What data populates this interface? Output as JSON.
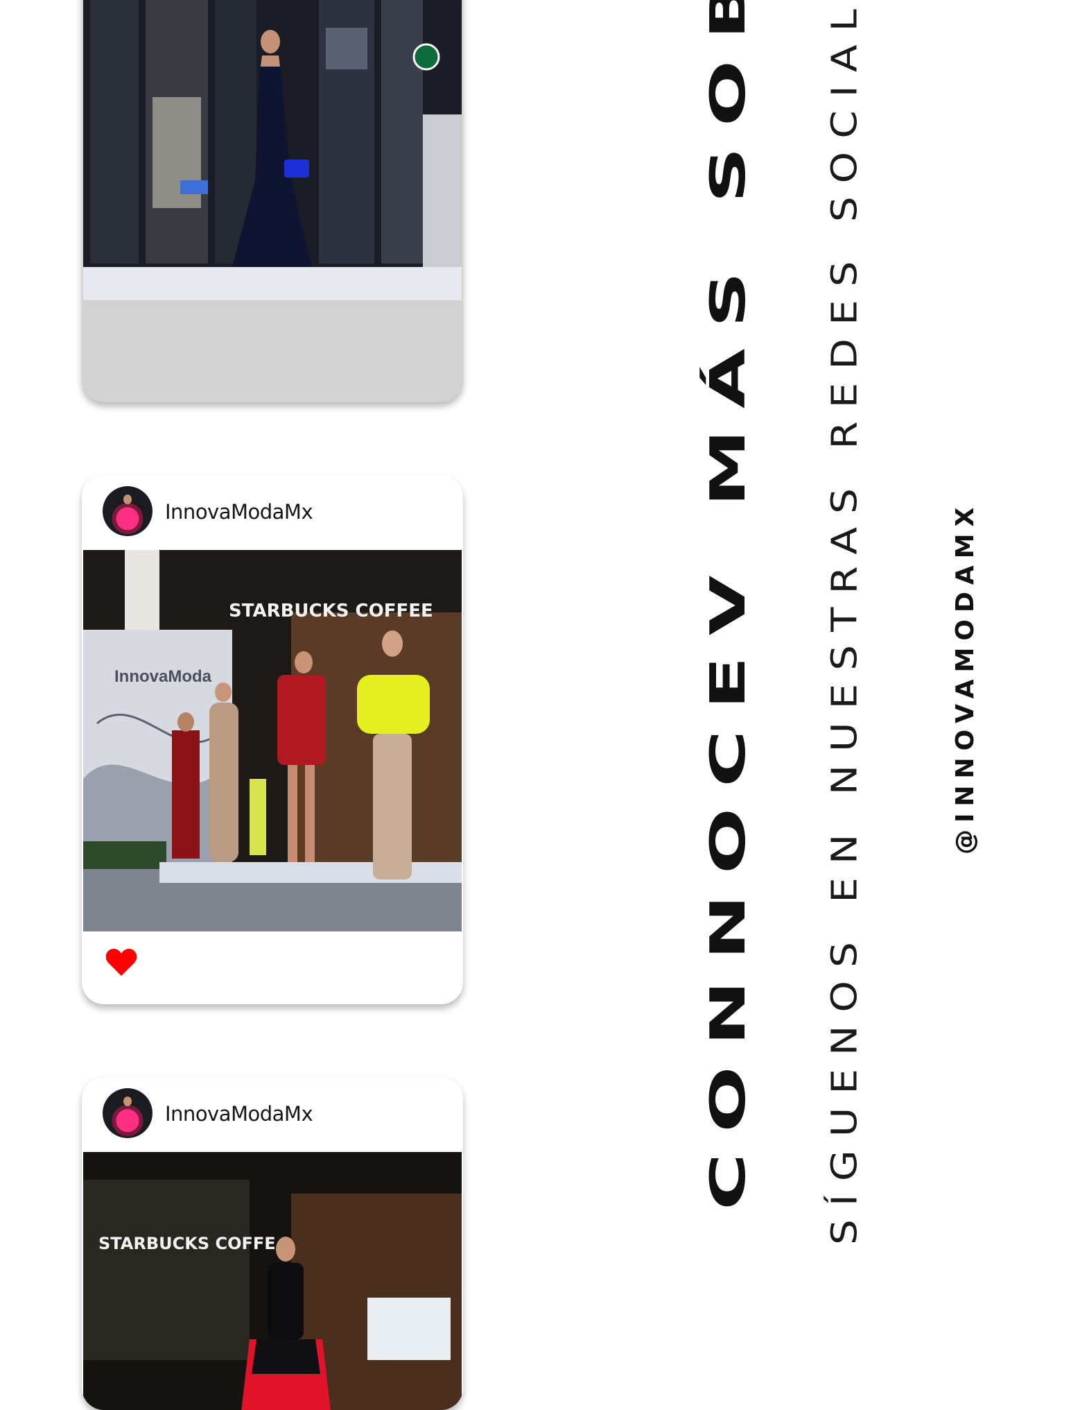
{
  "posts": [
    {
      "image": "model-black-sequin-gown-runway",
      "has_header": false
    },
    {
      "username": "InnovaModaMx",
      "image": "runway-group-starbucks-backdrop",
      "sign_texts": [
        "STARBUCKS COFFEE",
        "InnovaModa"
      ],
      "liked": true,
      "heart_color": "#ff0000"
    },
    {
      "username": "InnovaModaMx",
      "image": "model-black-red-tulle-dress-runway",
      "sign_texts": [
        "STARBUCKS COFFE"
      ]
    }
  ],
  "headline": "CONNOCEV MÁS SOBRE",
  "follow_text": "SÍGUENOS EN NUESTRAS REDES SOCIALES",
  "handle": "@INNOVAMODAMX",
  "colors": {
    "background": "#ffffff",
    "text": "#111111",
    "heart": "#ff0000"
  }
}
